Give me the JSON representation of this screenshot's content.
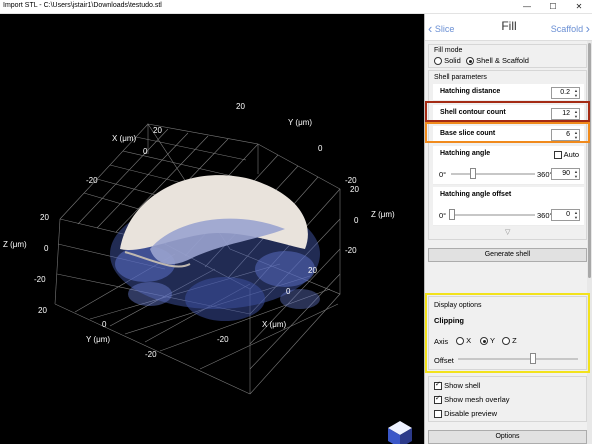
{
  "window": {
    "title": "Import STL - C:\\Users\\jstair1\\Downloads\\testudo.stl",
    "min_glyph": "—",
    "max_glyph": "☐",
    "close_glyph": "✕"
  },
  "viewport": {
    "axis_labels": {
      "x_top": "X (μm)",
      "y_top": "Y (μm)",
      "z_left": "Z (μm)",
      "z_right": "Z (μm)",
      "x_bottom": "X (μm)",
      "y_bottom": "Y (μm)"
    },
    "ticks": {
      "top_20a": "20",
      "top_20b": "20",
      "top_0a": "0",
      "top_0b": "0",
      "top_m20a": "-20",
      "top_m20b": "-20",
      "z_left_20": "20",
      "z_left_0": "0",
      "z_left_m20": "-20",
      "z_right_20": "20",
      "z_right_0": "0",
      "z_right_m20": "-20",
      "bot_20a": "20",
      "bot_0a": "0",
      "bot_m20a": "-20",
      "bot_20b": "20",
      "bot_0b": "0",
      "bot_m20b": "-20"
    }
  },
  "nav": {
    "back": "Slice",
    "current": "Fill",
    "forward": "Scaffold",
    "back_glyph": "‹",
    "fwd_glyph": "›"
  },
  "fill_mode": {
    "label": "Fill mode",
    "opt_solid": "Solid",
    "opt_shell": "Shell & Scaffold",
    "selected": "Shell & Scaffold"
  },
  "shell": {
    "label": "Shell parameters",
    "hatching_distance": {
      "label": "Hatching distance",
      "value": "0.2"
    },
    "contour_count": {
      "label": "Shell contour count",
      "value": "12"
    },
    "base_slice_count": {
      "label": "Base slice count",
      "value": "6"
    },
    "hatching_angle": {
      "label": "Hatching angle",
      "auto_label": "Auto",
      "min": "0°",
      "max": "360°",
      "value": "90",
      "level_fraction": 0.25
    },
    "hatching_offset": {
      "label": "Hatching angle offset",
      "min": "0°",
      "max": "360°",
      "value": "0",
      "level_fraction": 0
    },
    "more_glyph": "▽",
    "generate_label": "Generate shell"
  },
  "display": {
    "label": "Display options",
    "clipping": "Clipping",
    "axis_label": "Axis",
    "axis_x": "X",
    "axis_y": "Y",
    "axis_z": "Z",
    "axis_selected": "Y",
    "offset_label": "Offset",
    "offset_fraction": 0.62
  },
  "checks": {
    "show_shell": "Show shell",
    "show_mesh": "Show mesh overlay",
    "disable_preview": "Disable preview",
    "show_shell_on": true,
    "show_mesh_on": true,
    "disable_preview_on": false
  },
  "options_label": "Options",
  "colors": {
    "red_box": "#a42b14",
    "orange_box": "#f08a1c",
    "yellow_box": "#f2e21c",
    "link": "#6a8fd4",
    "shell": "#e9e3dc",
    "mesh": "#4a5fb8"
  }
}
